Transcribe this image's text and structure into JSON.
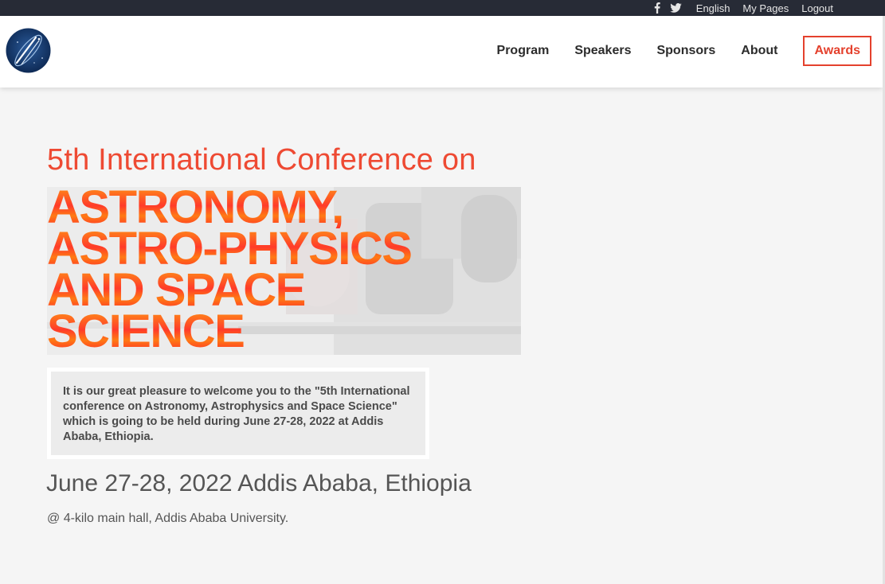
{
  "topbar": {
    "social_icons": [
      "facebook-icon",
      "twitter-icon"
    ],
    "language": "English",
    "my_pages": "My Pages",
    "logout": "Logout"
  },
  "header": {
    "logo_icon": "conference-logo-icon",
    "nav": [
      {
        "label": "Program"
      },
      {
        "label": "Speakers"
      },
      {
        "label": "Sponsors"
      },
      {
        "label": "About"
      },
      {
        "label": "Awards"
      }
    ]
  },
  "hero": {
    "subtitle": "5th International Conference on",
    "banner_lines": [
      "ASTRONOMY,",
      "ASTRO-PHYSICS",
      "AND SPACE",
      "SCIENCE"
    ],
    "welcome_text": "It is our great pleasure to welcome you to the \"5th International conference on Astronomy, Astrophysics and Space Science\" which is going to be held during June 27-28, 2022 at Addis Ababa, Ethiopia.",
    "date_location": "June 27-28, 2022 Addis Ababa, Ethiopia",
    "venue": "@ 4-kilo main hall, Addis Ababa University."
  },
  "colors": {
    "accent": "#e4412d",
    "topbar_bg": "#272b36",
    "page_bg": "#f5f5f5"
  }
}
